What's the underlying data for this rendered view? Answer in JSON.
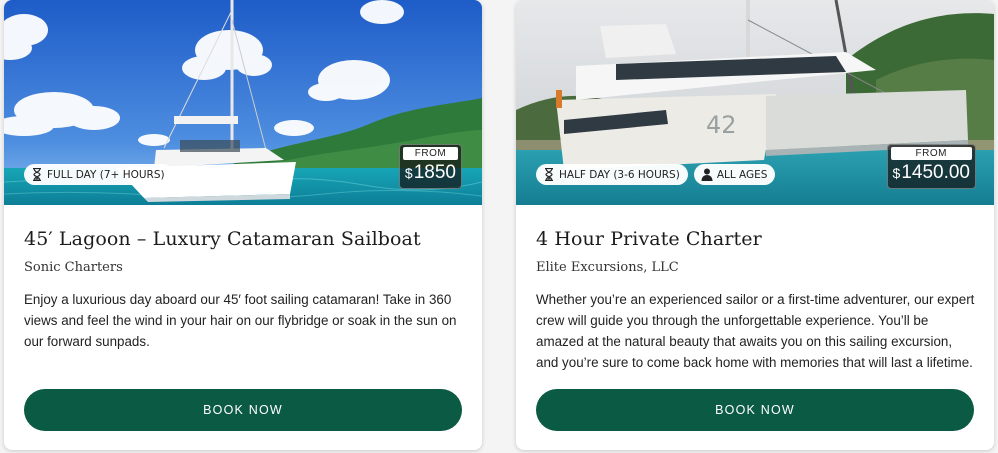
{
  "listings": [
    {
      "title": "45′ Lagoon – Luxury Catamaran Sailboat",
      "operator": "Sonic Charters",
      "description": "Enjoy a luxurious day aboard our 45′ foot sailing catamaran! Take in 360 views and feel the wind in your hair on our flybridge or soak in the sun on our forward sunpads.",
      "duration_badge": "FULL DAY (7+ HOURS)",
      "price_label": "FROM",
      "currency": "$",
      "price": "1850",
      "book_label": "BOOK NOW",
      "photo_icon": "sailing-catamaran-photo"
    },
    {
      "title": "4 Hour Private Charter",
      "operator": "Elite Excursions, LLC",
      "description": "Whether you’re an experienced sailor or a first-time adventurer, our expert crew will guide you through the unforgettable experience. You’ll be amazed at the natural beauty that awaits you on this sailing excursion, and you’re sure to come back home with memories that will last a lifetime.",
      "duration_badge": "HALF DAY (3-6 HOURS)",
      "age_badge": "ALL AGES",
      "price_label": "FROM",
      "currency": "$",
      "price": "1450.00",
      "book_label": "BOOK NOW",
      "hull_number": "42",
      "photo_icon": "moored-catamaran-photo"
    }
  ],
  "colors": {
    "button": "#0b5a43",
    "sea": "#1aa8b8",
    "sky": "#2f6fd0"
  }
}
